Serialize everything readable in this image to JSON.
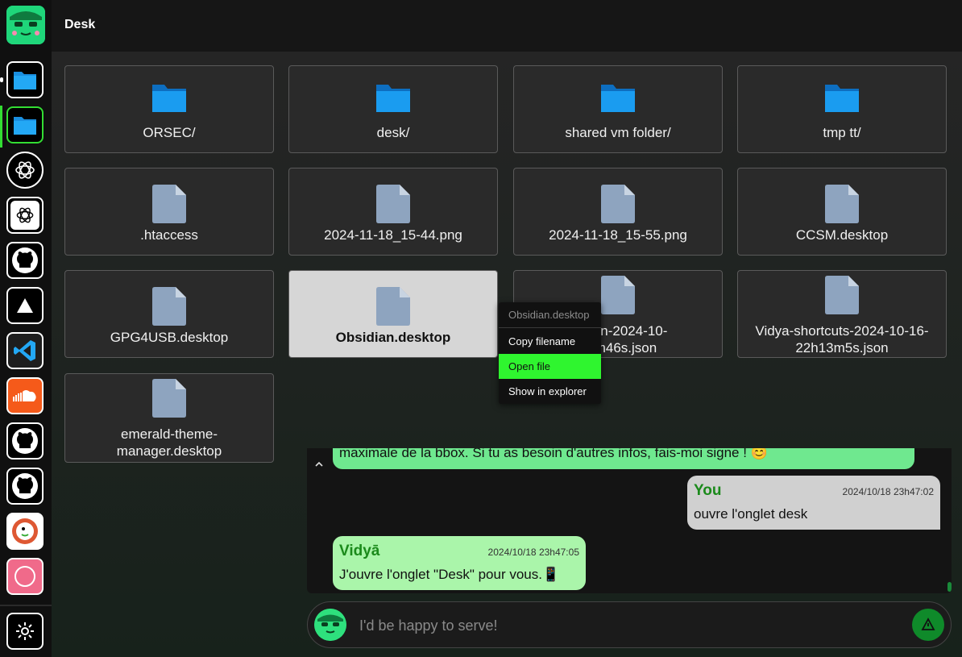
{
  "header": {
    "title": "Desk"
  },
  "dock": {
    "apps": [
      {
        "name": "files-folder-icon"
      },
      {
        "name": "desk-folder-icon"
      },
      {
        "name": "chatgpt-icon"
      },
      {
        "name": "chatgpt-alt-icon"
      },
      {
        "name": "github-icon"
      },
      {
        "name": "vercel-icon"
      },
      {
        "name": "vscode-icon"
      },
      {
        "name": "soundcloud-icon"
      },
      {
        "name": "github-icon"
      },
      {
        "name": "github-icon"
      },
      {
        "name": "duckduckgo-icon"
      },
      {
        "name": "circle-app-icon"
      }
    ],
    "settings": "gear-icon"
  },
  "files": [
    {
      "label": "ORSEC/",
      "type": "folder"
    },
    {
      "label": "desk/",
      "type": "folder"
    },
    {
      "label": "shared vm folder/",
      "type": "folder"
    },
    {
      "label": "tmp tt/",
      "type": "folder"
    },
    {
      "label": ".htaccess",
      "type": "file"
    },
    {
      "label": "2024-11-18_15-44.png",
      "type": "file"
    },
    {
      "label": "2024-11-18_15-55.png",
      "type": "file"
    },
    {
      "label": "CCSM.desktop",
      "type": "file"
    },
    {
      "label": "GPG4USB.desktop",
      "type": "file"
    },
    {
      "label": "Obsidian.desktop",
      "type": "file",
      "selected": true
    },
    {
      "label_line1": "ussion-2024-10-",
      "label_line2": "34m46s.json",
      "type": "file"
    },
    {
      "label_line1": "Vidya-shortcuts-2024-10-16-",
      "label_line2": "22h13m5s.json",
      "type": "file"
    },
    {
      "label_line1": "emerald-theme-",
      "label_line2": "manager.desktop",
      "type": "file"
    }
  ],
  "context_menu": {
    "header": "Obsidian.desktop",
    "items": [
      {
        "label": "Copy filename"
      },
      {
        "label": "Open file",
        "highlighted": true
      },
      {
        "label": "Show in explorer"
      }
    ]
  },
  "chat": {
    "previous_text": "maximale de la bbox. Si tu as besoin d'autres infos, fais-moi signe ! 😊",
    "messages": [
      {
        "author": "You",
        "time": "2024/10/18 23h47:02",
        "text": "ouvre l'onglet desk"
      },
      {
        "author": "Vidyā",
        "time": "2024/10/18 23h47:05",
        "text": "J'ouvre l'onglet \"Desk\" pour vous.📱"
      }
    ],
    "collapse_icon": "chevron-up-icon"
  },
  "input": {
    "placeholder": "I'd be happy to serve!"
  },
  "colors": {
    "accent": "#2ff52f",
    "folder": "#1a8fe0",
    "file": "#8ea4bf",
    "bot_bubble": "#aaf5aa",
    "user_bubble": "#d0d0d0"
  }
}
